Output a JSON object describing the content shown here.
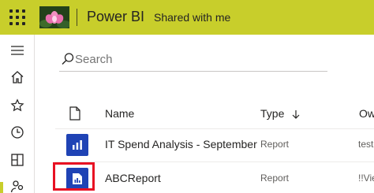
{
  "header": {
    "app_name": "Power BI",
    "breadcrumb": "Shared with me",
    "background_color": "#c8ce2b"
  },
  "icons": {
    "waffle": "app-launcher-icon",
    "logo": "lotus-flower-logo",
    "hamburger": "menu-icon",
    "home": "home-icon",
    "favorites": "star-icon",
    "recent": "clock-icon",
    "apps": "apps-icon",
    "shared": "shared-people-icon",
    "search": "search-icon",
    "file": "document-icon",
    "report": "report-chart-icon",
    "sort": "arrow-down-icon"
  },
  "search": {
    "placeholder": "Search"
  },
  "table": {
    "columns": {
      "name": "Name",
      "type": "Type",
      "owner": "Ow"
    },
    "rows": [
      {
        "name": "IT Spend Analysis - September",
        "type": "Report",
        "owner": "test"
      },
      {
        "name": "ABCReport",
        "type": "Report",
        "owner": "!!Vie"
      }
    ]
  },
  "colors": {
    "accent": "#c8ce2b",
    "report_icon": "#1f43b5",
    "highlight": "#e81123"
  }
}
